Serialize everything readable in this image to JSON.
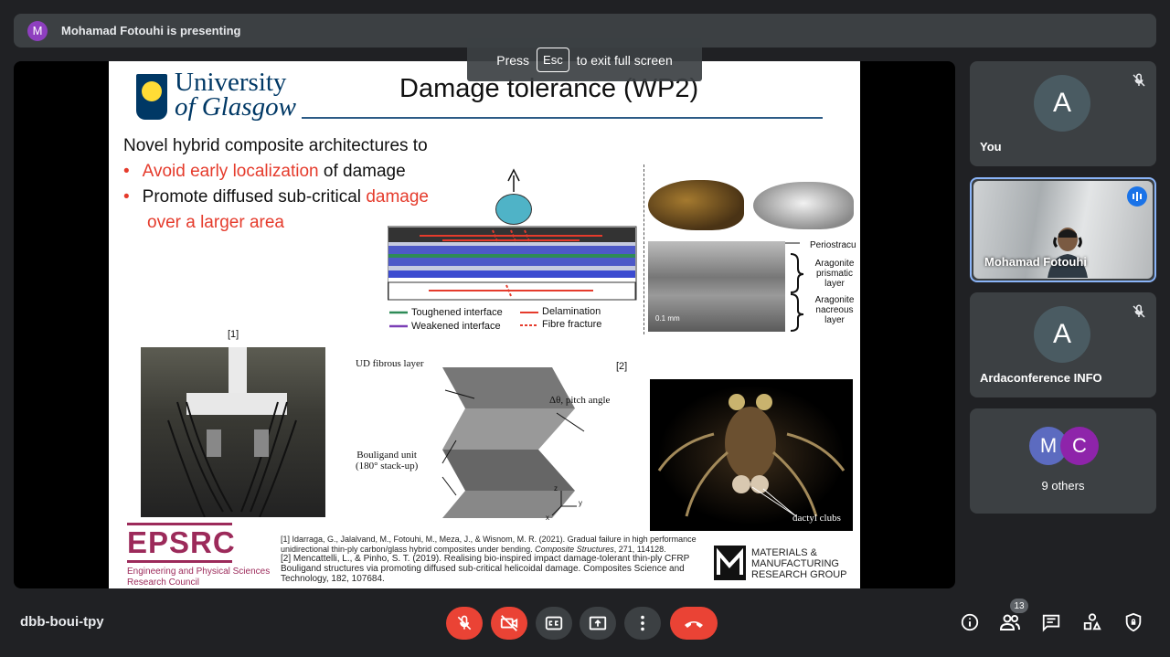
{
  "banner": {
    "avatar_letter": "M",
    "text": "Mohamad Fotouhi is presenting"
  },
  "fullscreen_hint": {
    "prefix": "Press",
    "key": "Esc",
    "suffix": "to exit full screen"
  },
  "slide": {
    "university_line1": "University",
    "university_line2": "of Glasgow",
    "title": "Damage tolerance (WP2)",
    "intro": "Novel hybrid composite architectures to",
    "bullet1_red": "Avoid early localization",
    "bullet1_rest": " of damage",
    "bullet2_black": "Promote diffused sub-critical ",
    "bullet2_red": "damage",
    "bullet2_cont": "over a larger area",
    "legend": {
      "toughened": "Toughened interface",
      "weakened": "Weakened interface",
      "delamination": "Delamination",
      "fibre": "Fibre fracture"
    },
    "shell_labels": {
      "periostracum": "Periostracu",
      "arag1a": "Aragonite",
      "arag1b": "prismatic",
      "arag1c": "layer",
      "arag2a": "Aragonite",
      "arag2b": "nacreous",
      "arag2c": "layer",
      "scale": "0.1 mm"
    },
    "ref1_tag": "[1]",
    "ref2_tag": "[2]",
    "bouligand": {
      "ud": "UD fibrous layer",
      "pitch": "Δθ, pitch angle",
      "unit1": "Bouligand unit",
      "unit2": "(180° stack-up)",
      "axis_z": "z",
      "axis_y": "y",
      "axis_x": "x"
    },
    "mantis_label": "dactyl clubs",
    "epsrc_logo": "EPSRC",
    "epsrc_sub1": "Engineering and Physical Sciences",
    "epsrc_sub2": "Research Council",
    "references": {
      "r1a": "[1] Idarraga, G., Jalalvand, M., Fotouhi, M., Meza, J., & Wisnom, M. R. (2021). Gradual failure in high performance",
      "r1b": "unidirectional thin-ply carbon/glass hybrid composites under bending. ",
      "r1c": "Composite Structures",
      "r1d": ", 271, 114128.",
      "r2a": "[2] Mencattelli, L., & Pinho, S. T. (2019). Realising bio-inspired impact damage-tolerant thin-ply CFRP",
      "r2b": "Bouligand structures via promoting diffused sub-critical helicoidal damage. Composites Science and",
      "r2c": "Technology, 182, 107684."
    },
    "mmrg": {
      "l1": "MATERIALS &",
      "l2": "MANUFACTURING",
      "l3": "RESEARCH GROUP"
    }
  },
  "participants": {
    "you": {
      "letter": "A",
      "name": "You"
    },
    "presenter": {
      "name": "Mohamad Fotouhi"
    },
    "arda": {
      "letter": "A",
      "name": "Ardaconference INFO"
    },
    "others": {
      "m": "M",
      "c": "C",
      "label": "9 others"
    }
  },
  "bottom": {
    "meeting_code": "dbb-boui-tpy",
    "people_count": "13"
  },
  "colors": {
    "accent": "#8ab4f8",
    "danger": "#ea4335",
    "panel": "#3c4043",
    "bg": "#202124"
  }
}
